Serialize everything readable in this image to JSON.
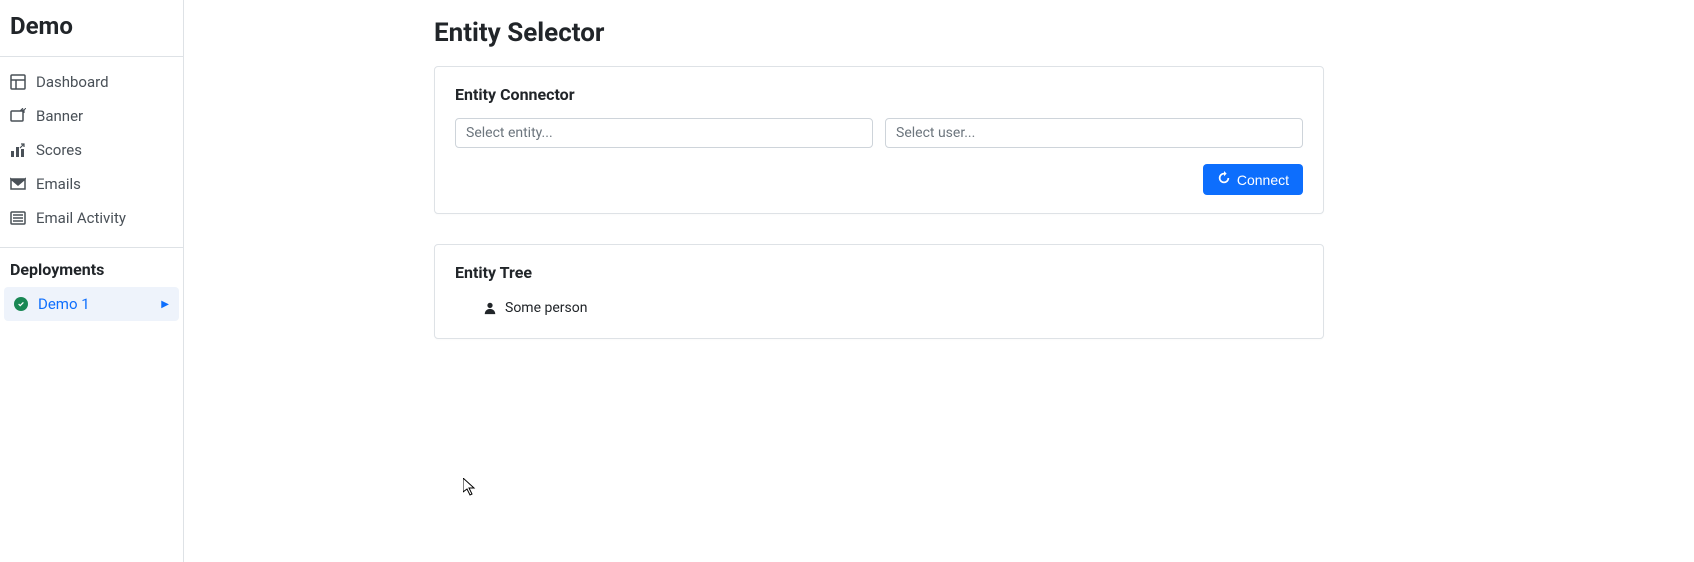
{
  "brand": "Demo",
  "sidebar": {
    "nav": [
      {
        "label": "Dashboard",
        "icon": "dashboard-icon"
      },
      {
        "label": "Banner",
        "icon": "banner-icon"
      },
      {
        "label": "Scores",
        "icon": "scores-icon"
      },
      {
        "label": "Emails",
        "icon": "emails-icon"
      },
      {
        "label": "Email Activity",
        "icon": "activity-icon"
      }
    ],
    "deployments_header": "Deployments",
    "deployments": [
      {
        "label": "Demo 1",
        "status": "success"
      }
    ]
  },
  "page": {
    "title": "Entity Selector"
  },
  "connector": {
    "title": "Entity Connector",
    "entity_placeholder": "Select entity...",
    "user_placeholder": "Select user...",
    "connect_label": "Connect"
  },
  "tree": {
    "title": "Entity Tree",
    "items": [
      {
        "label": "Some person"
      }
    ]
  }
}
